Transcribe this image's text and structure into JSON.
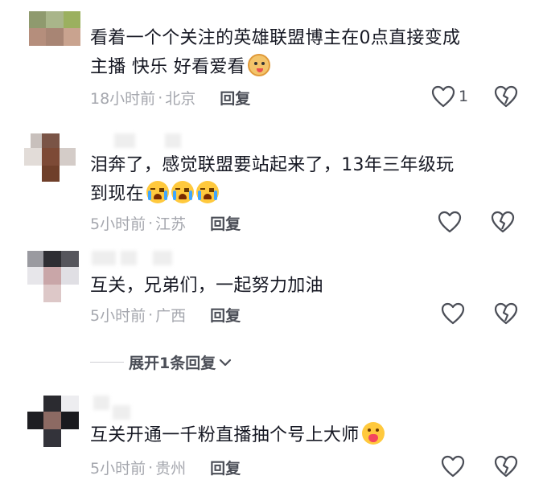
{
  "comments": [
    {
      "text_line1": "看着一个个关注的英雄联盟博主在0点直接变成",
      "text_line2": "主播 快乐 好看爱看",
      "emoji": "doge-emoji",
      "time": "18小时前",
      "sep": "·",
      "location": "北京",
      "reply_label": "回复",
      "likes": "1"
    },
    {
      "text_line1": "泪奔了，感觉联盟要站起来了，13年三年级玩",
      "text_line2": "到现在",
      "emoji": "crying-emoji",
      "time": "5小时前",
      "sep": "·",
      "location": "江苏",
      "reply_label": "回复"
    },
    {
      "text_line1": "互关，兄弟们，一起努力加油",
      "time": "5小时前",
      "sep": "·",
      "location": "广西",
      "reply_label": "回复"
    },
    {
      "text_line1": "互关开通一千粉直播抽个号上大师",
      "emoji": "hugging-emoji",
      "time": "5小时前",
      "sep": "·",
      "location": "贵州",
      "reply_label": "回复"
    }
  ],
  "expand_replies_label": "展开1条回复",
  "colors": {
    "text": "#161823",
    "meta": "#a5a7ae",
    "action": "#4b4e57"
  }
}
